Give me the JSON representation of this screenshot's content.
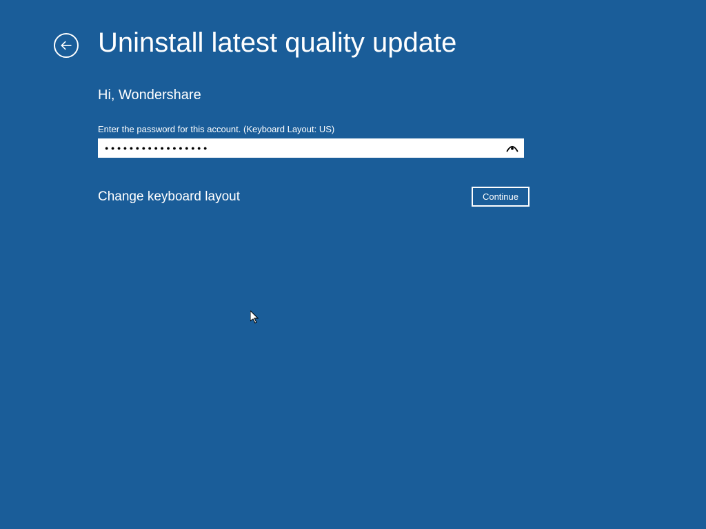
{
  "header": {
    "title": "Uninstall latest quality update"
  },
  "content": {
    "greeting": "Hi, Wondershare",
    "instruction": "Enter the password for this account. (Keyboard Layout: US)",
    "password_value": "●●●●●●●●●●●●●●●●●",
    "change_layout_label": "Change keyboard layout",
    "continue_label": "Continue"
  },
  "icons": {
    "back": "back-arrow-icon",
    "reveal": "eye-reveal-icon"
  }
}
